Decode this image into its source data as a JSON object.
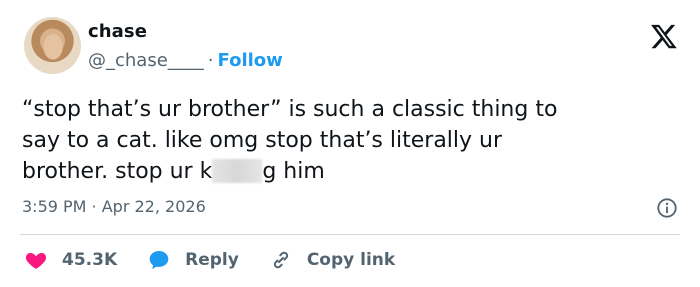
{
  "author": {
    "display_name": "chase",
    "handle": "@_chase____",
    "separator": "·",
    "follow_label": "Follow"
  },
  "tweet": {
    "text_before": "“stop that’s ur brother” is such a classic thing to\nsay to a cat. like omg stop that’s literally ur\nbrother. stop ur k",
    "text_after": "g him",
    "timestamp": "3:59 PM · Apr 22, 2026"
  },
  "actions": {
    "likes_count": "45.3K",
    "reply_label": "Reply",
    "copy_link_label": "Copy link"
  },
  "icons": {
    "logo": "x-logo-icon",
    "info": "info-icon",
    "like": "heart-icon",
    "reply": "speech-bubble-icon",
    "copy": "link-icon"
  },
  "colors": {
    "like": "#f91880",
    "reply": "#1d9bf0",
    "follow": "#1d9bf0",
    "muted": "#536471"
  }
}
